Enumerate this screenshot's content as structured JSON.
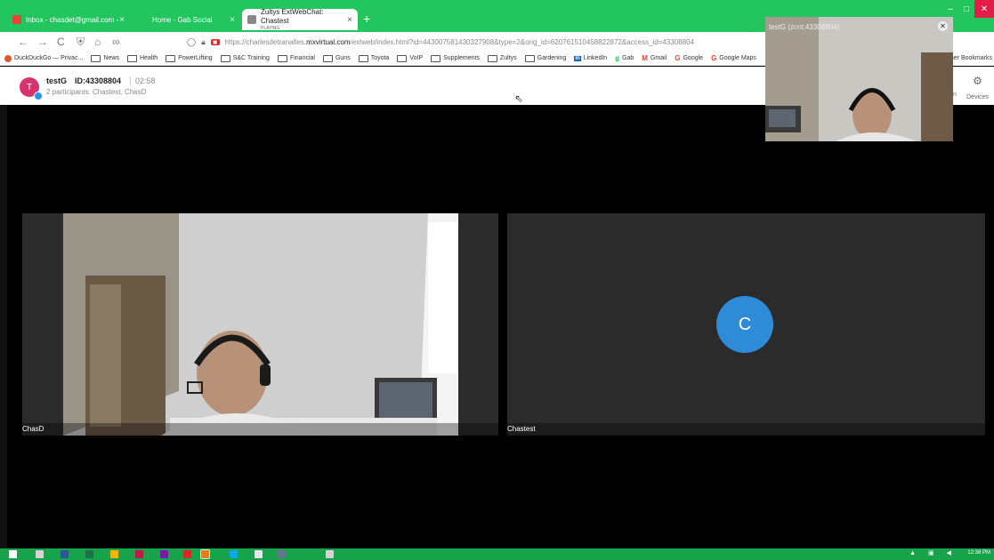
{
  "browser": {
    "tabs": [
      {
        "title": "Inbox - chasdet@gmail.com - ",
        "favicon_color": "#ea4335",
        "active": false
      },
      {
        "title": "Home - Gab Social",
        "favicon_color": "#22c55e",
        "active": false
      },
      {
        "title": "Zultys ExtWebChat: Chastest",
        "subtitle": "PLAYING",
        "favicon_color": "#888888",
        "active": true
      }
    ],
    "new_tab_symbol": "+",
    "window_controls": [
      "–",
      "□",
      "✕"
    ],
    "nav": {
      "back_icon": "←",
      "forward_icon": "→",
      "reload_icon": "C",
      "home_icon": "⌂",
      "extra_icon": "∞"
    },
    "url": {
      "scheme": "https://",
      "host_prefix": "charlesdetranaltes.",
      "host": "mxvirtual.com",
      "path": "/extweb/index.html?id=443007581430327908&type=2&orig_id=620761510458822872&access_id=43308804"
    },
    "bookmarks": [
      {
        "label": "DuckDuckGo — Privac...",
        "icon": "duckduckgo-icon"
      },
      {
        "label": "News",
        "icon": "folder-icon"
      },
      {
        "label": "Health",
        "icon": "folder-icon"
      },
      {
        "label": "PowerLifting",
        "icon": "folder-icon"
      },
      {
        "label": "S&C Training",
        "icon": "folder-icon"
      },
      {
        "label": "Financial",
        "icon": "folder-icon"
      },
      {
        "label": "Guns",
        "icon": "folder-icon"
      },
      {
        "label": "Toyota",
        "icon": "folder-icon"
      },
      {
        "label": "VoIP",
        "icon": "folder-icon"
      },
      {
        "label": "Supplements",
        "icon": "folder-icon"
      },
      {
        "label": "Zultys",
        "icon": "folder-icon"
      },
      {
        "label": "Gardening",
        "icon": "folder-icon"
      },
      {
        "label": "LinkedIn",
        "icon": "linkedin-icon"
      },
      {
        "label": "Gab",
        "icon": "gab-icon"
      },
      {
        "label": "Gmail",
        "icon": "gmail-icon"
      },
      {
        "label": "Google",
        "icon": "google-icon"
      },
      {
        "label": "Google Maps",
        "icon": "google-icon"
      }
    ],
    "other_bookmarks": "ther Bookmarks"
  },
  "call": {
    "avatar_letter": "T",
    "name": "testG",
    "id_label": "ID:43308804",
    "timer": "02:58",
    "participants": "2 participants: Chastest, ChasD",
    "devices_label": "Devices",
    "n_label": "n"
  },
  "tiles": [
    {
      "name": "ChasD",
      "type": "video"
    },
    {
      "name": "Chastest",
      "type": "avatar",
      "avatar_letter": "C",
      "avatar_color": "#2d8bd8"
    }
  ],
  "pip": {
    "title": "testG (zcnt:43308804)",
    "close": "✕"
  },
  "taskbar": {
    "time": "12:38 PM",
    "tray": "▲ ▣ ◀"
  },
  "colors": {
    "chrome_green": "#22c55e",
    "taskbar_green": "#17a34a",
    "avatar_pink": "#d6336c",
    "accent_blue": "#2196f3"
  }
}
